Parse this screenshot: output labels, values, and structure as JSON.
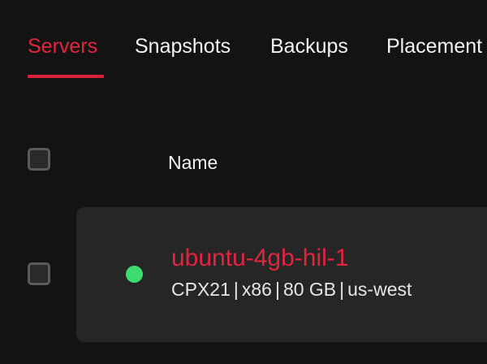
{
  "tabs": [
    {
      "label": "Servers",
      "active": true
    },
    {
      "label": "Snapshots",
      "active": false
    },
    {
      "label": "Backups",
      "active": false
    },
    {
      "label": "Placement",
      "active": false
    }
  ],
  "table": {
    "columns": {
      "name": "Name"
    },
    "rows": [
      {
        "name": "ubuntu-4gb-hil-1",
        "status": "running",
        "status_color": "#3ddc6f",
        "type": "CPX21",
        "arch": "x86",
        "disk": "80 GB",
        "location": "us-west",
        "separator": "|"
      }
    ]
  },
  "colors": {
    "accent": "#e2253f",
    "background": "#131313",
    "card": "#262626",
    "status_running": "#3ddc6f"
  }
}
